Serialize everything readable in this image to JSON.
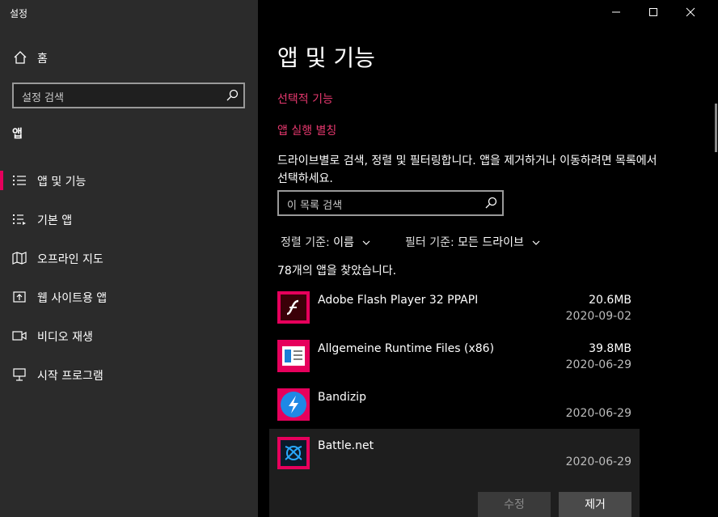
{
  "window": {
    "title": "설정"
  },
  "sidebar": {
    "home_label": "홈",
    "search_placeholder": "설정 검색",
    "section_title": "앱",
    "items": [
      {
        "label": "앱 및 기능",
        "icon": "list-icon",
        "active": true
      },
      {
        "label": "기본 앱",
        "icon": "default-apps-icon"
      },
      {
        "label": "오프라인 지도",
        "icon": "map-icon"
      },
      {
        "label": "웹 사이트용 앱",
        "icon": "open-in-app-icon"
      },
      {
        "label": "비디오 재생",
        "icon": "video-icon"
      },
      {
        "label": "시작 프로그램",
        "icon": "startup-icon"
      }
    ]
  },
  "main": {
    "title": "앱 및 기능",
    "links": {
      "optional_features": "선택적 기능",
      "app_aliases": "앱 실행 별칭"
    },
    "description": "드라이브별로 검색, 정렬 및 필터링합니다. 앱을 제거하거나 이동하려면 목록에서 선택하세요.",
    "list_search_placeholder": "이 목록 검색",
    "sort": {
      "label": "정렬 기준:",
      "value": "이름"
    },
    "filter": {
      "label": "필터 기준:",
      "value": "모든 드라이브"
    },
    "count_text": "78개의 앱을 찾았습니다.",
    "apps": [
      {
        "name": "Adobe Flash Player 32 PPAPI",
        "size": "20.6MB",
        "date": "2020-09-02",
        "icon": "flash-icon"
      },
      {
        "name": "Allgemeine Runtime Files (x86)",
        "size": "39.8MB",
        "date": "2020-06-29",
        "icon": "runtime-icon"
      },
      {
        "name": "Bandizip",
        "size": "",
        "date": "2020-06-29",
        "icon": "bandizip-icon"
      },
      {
        "name": "Battle.net",
        "size": "",
        "date": "2020-06-29",
        "icon": "battlenet-icon",
        "selected": true
      }
    ],
    "buttons": {
      "modify": "수정",
      "uninstall": "제거"
    }
  },
  "colors": {
    "accent": "#e6005c",
    "link": "#e6386e",
    "sidebar_bg": "#2b2b2b",
    "main_bg": "#000000"
  }
}
